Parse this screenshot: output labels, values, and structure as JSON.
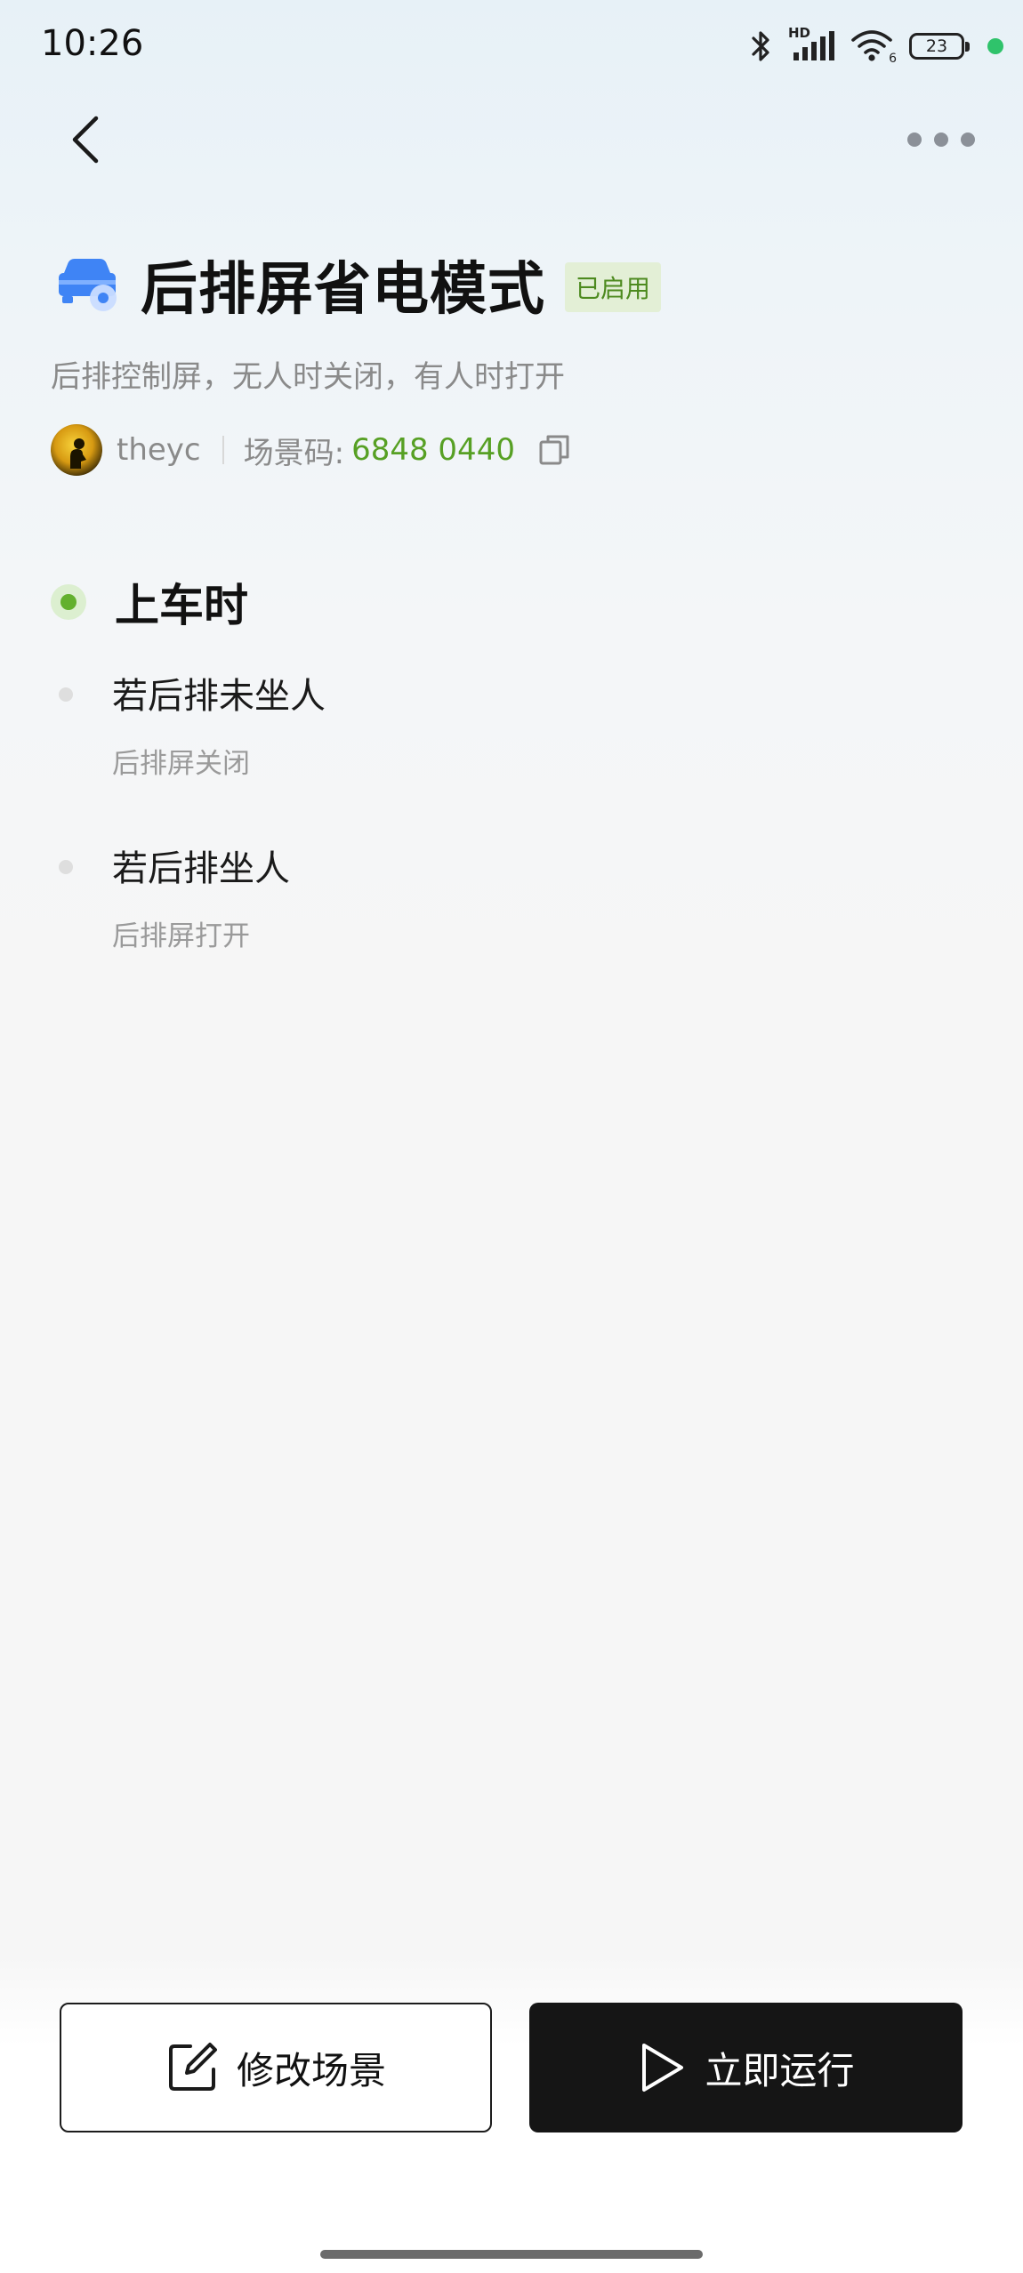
{
  "status_bar": {
    "time": "10:26",
    "hd_label": "HD",
    "wifi_label": "6",
    "battery": "23",
    "icons": [
      "bluetooth-icon",
      "signal-icon",
      "wifi-icon",
      "battery-icon"
    ]
  },
  "nav": {
    "back_icon": "chevron-left-icon",
    "more_icon": "more-horizontal-icon"
  },
  "scene": {
    "title": "后排屏省电模式",
    "status_badge": "已启用",
    "description": "后排控制屏，无人时关闭，有人时打开",
    "author": "theyc",
    "code_label": "场景码:",
    "code_value": "6848 0440",
    "icon": "car-scene-icon"
  },
  "trigger": {
    "label": "上车时"
  },
  "conditions": [
    {
      "title": "若后排未坐人",
      "action": "后排屏关闭"
    },
    {
      "title": "若后排坐人",
      "action": "后排屏打开"
    }
  ],
  "buttons": {
    "edit": "修改场景",
    "run": "立即运行"
  },
  "colors": {
    "accent_green": "#57a024",
    "badge_bg": "#e3efd6",
    "primary_button": "#151515"
  }
}
